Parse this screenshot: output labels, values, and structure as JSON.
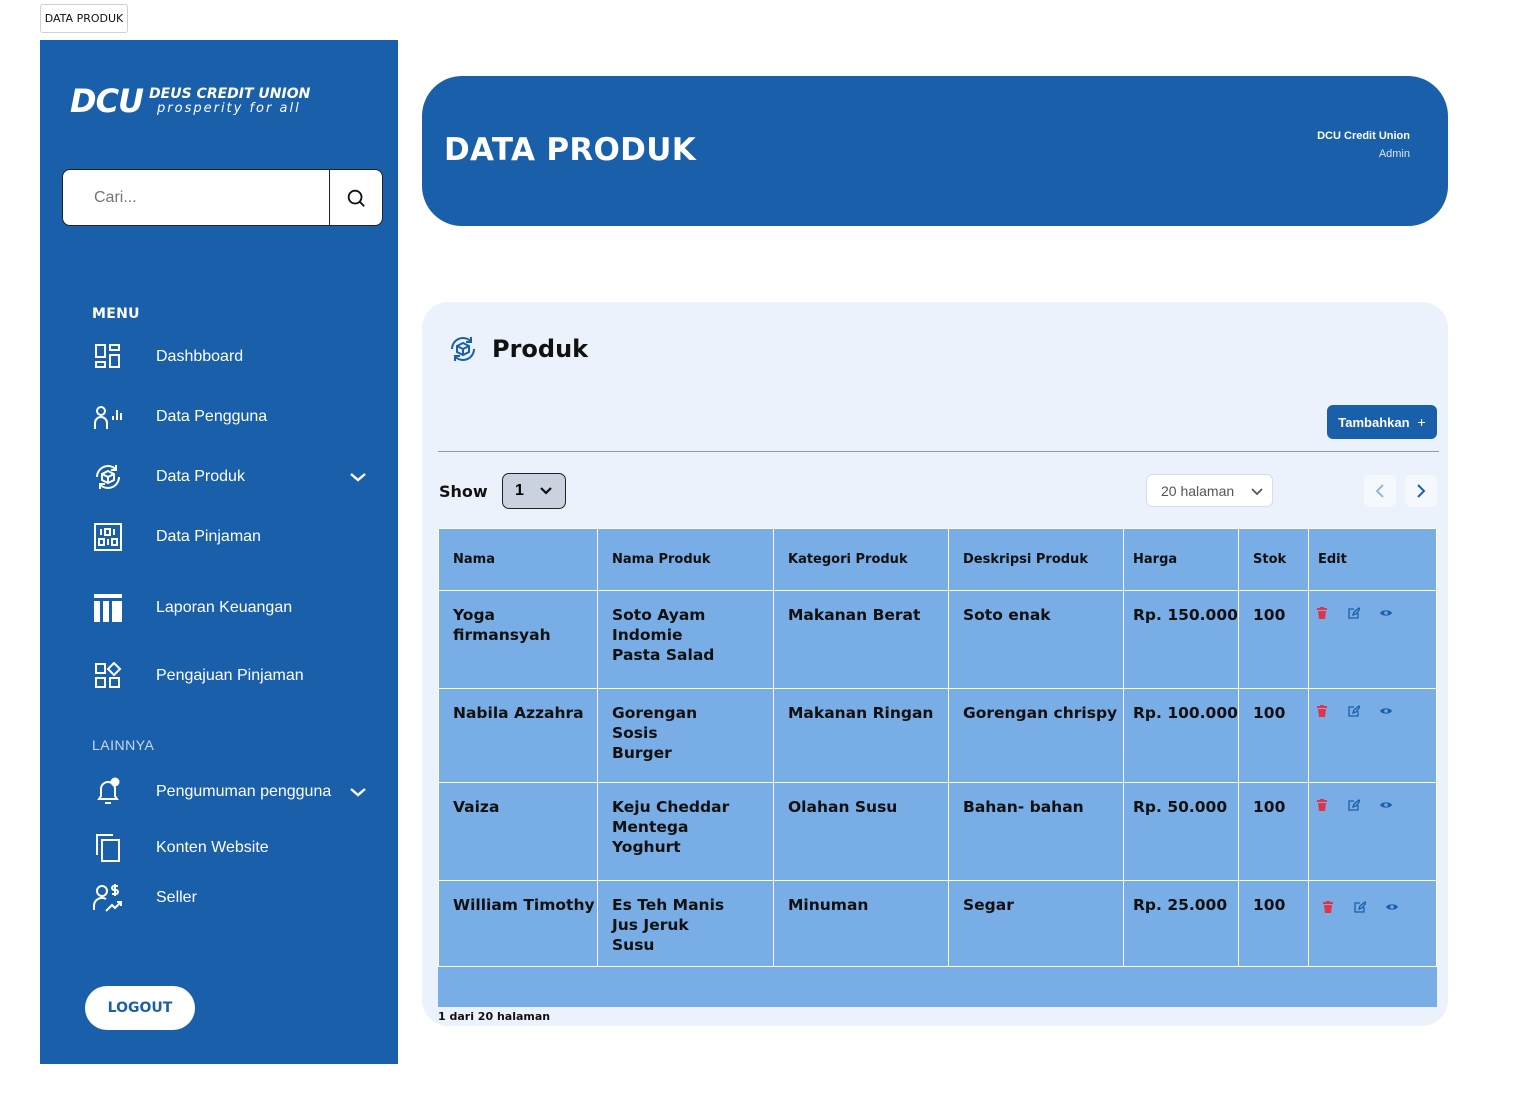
{
  "frame_label": "DATA PRODUK",
  "sidebar": {
    "logo_mark": "DCU",
    "logo_name": "DEUS CREDIT UNION",
    "logo_tagline": "prosperity for all",
    "search_placeholder": "Cari...",
    "menu_heading": "MENU",
    "items": [
      {
        "label": "Dashbboard",
        "icon": "dashboard-icon"
      },
      {
        "label": "Data Pengguna",
        "icon": "user-stats-icon"
      },
      {
        "label": "Data Produk",
        "icon": "product-box-icon"
      },
      {
        "label": "Data Pinjaman",
        "icon": "binary-board-icon"
      },
      {
        "label": "Laporan Keuangan",
        "icon": "report-table-icon"
      },
      {
        "label": "Pengajuan Pinjaman",
        "icon": "apps-shapes-icon"
      }
    ],
    "other_heading": "LAINNYA",
    "other_items": [
      {
        "label": "Pengumuman pengguna",
        "icon": "bell-icon"
      },
      {
        "label": "Konten Website",
        "icon": "copy-icon"
      },
      {
        "label": "Seller",
        "icon": "seller-icon"
      }
    ],
    "logout_label": "LOGOUT"
  },
  "header": {
    "title": "DATA PRODUK",
    "org": "DCU Credit Union",
    "role": "Admin"
  },
  "panel": {
    "title": "Produk",
    "add_label": "Tambahkan",
    "add_icon": "+",
    "show_label": "Show",
    "show_value": "1",
    "pages_select": "20 halaman",
    "pager_text": "1 dari 20 halaman"
  },
  "table": {
    "headers": [
      "Nama",
      "Nama Produk",
      "Kategori Produk",
      "Deskripsi Produk",
      "Harga",
      "Stok",
      "Edit"
    ],
    "rows": [
      {
        "nama": "Yoga firmansyah",
        "produk": [
          "Soto Ayam",
          "Indomie",
          "Pasta Salad"
        ],
        "kategori": "Makanan Berat",
        "deskripsi": "Soto enak",
        "harga": "Rp. 150.000",
        "stok": "100"
      },
      {
        "nama": "Nabila Azzahra",
        "produk": [
          "Gorengan",
          "Sosis",
          "Burger"
        ],
        "kategori": "Makanan Ringan",
        "deskripsi": "Gorengan chrispy",
        "harga": "Rp. 100.000",
        "stok": "100"
      },
      {
        "nama": "Vaiza",
        "produk": [
          "Keju Cheddar",
          "Mentega",
          "Yoghurt"
        ],
        "kategori": "Olahan Susu",
        "deskripsi": "Bahan- bahan",
        "harga": "Rp. 50.000",
        "stok": "100"
      },
      {
        "nama": "William Timothy",
        "produk": [
          "Es Teh Manis",
          "Jus Jeruk",
          "Susu"
        ],
        "kategori": "Minuman",
        "deskripsi": "Segar",
        "harga": "Rp. 25.000",
        "stok": "100"
      }
    ]
  },
  "colors": {
    "primary": "#1a5faa",
    "table_bg": "#78ade6",
    "panel_bg": "#ecf2fb",
    "delete": "#e0344a",
    "edit": "#1a5faa"
  }
}
